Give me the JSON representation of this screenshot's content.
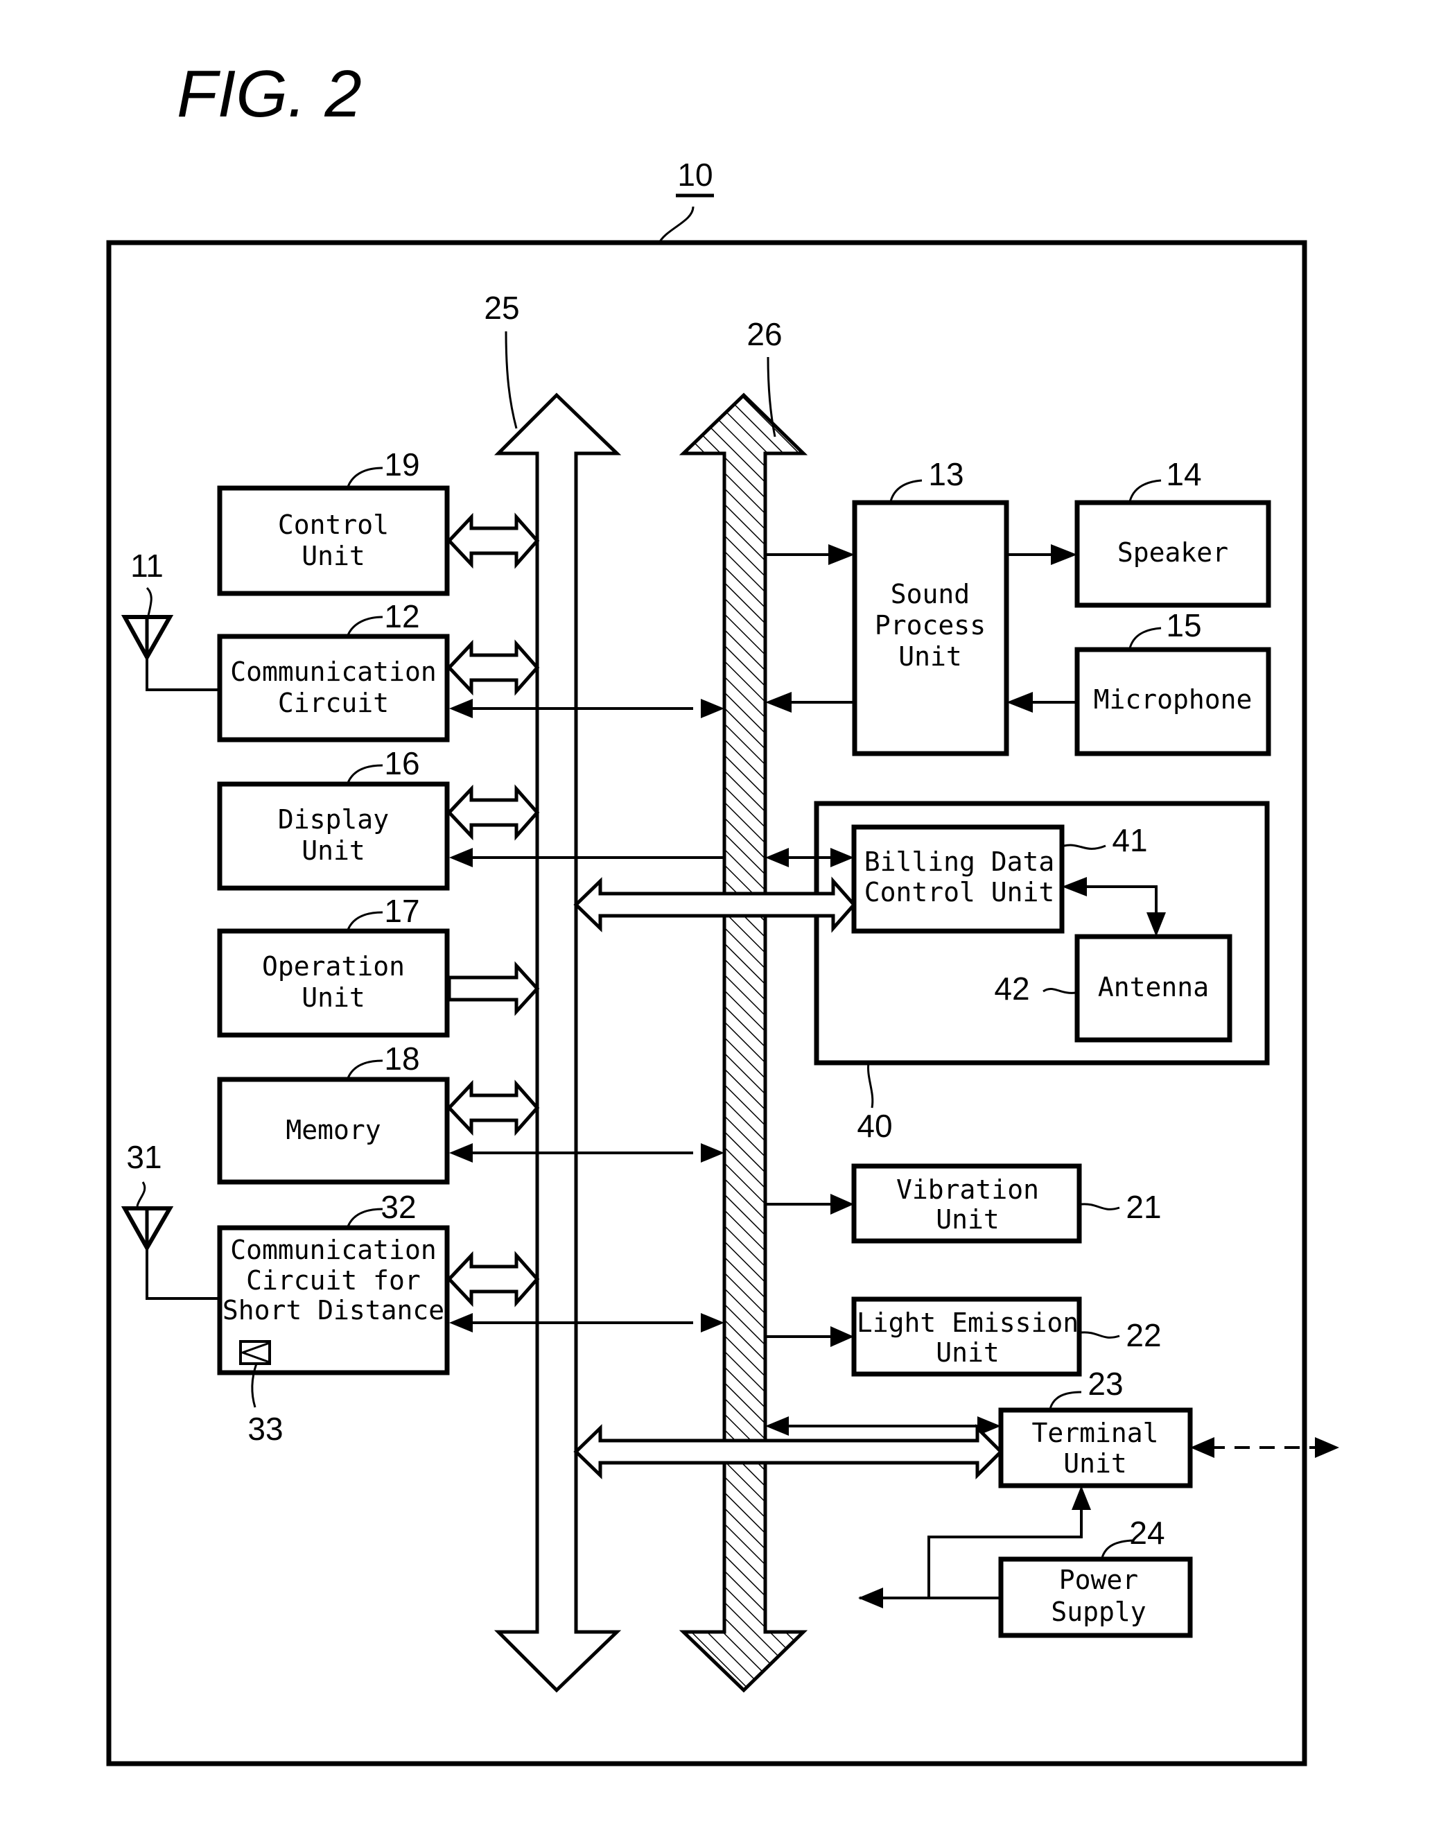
{
  "figure": {
    "title": "FIG. 2",
    "device_ref": "10"
  },
  "buses": [
    {
      "id": "bus25",
      "ref": "25",
      "style": "hollow"
    },
    {
      "id": "bus26",
      "ref": "26",
      "style": "hatched"
    }
  ],
  "blocks": {
    "control_unit": {
      "ref": "19",
      "lines": [
        "Control",
        "Unit"
      ]
    },
    "communication_circuit": {
      "ref": "12",
      "lines": [
        "Communication",
        "Circuit"
      ]
    },
    "display_unit": {
      "ref": "16",
      "lines": [
        "Display",
        "Unit"
      ]
    },
    "operation_unit": {
      "ref": "17",
      "lines": [
        "Operation",
        "Unit"
      ]
    },
    "memory": {
      "ref": "18",
      "lines": [
        "Memory"
      ]
    },
    "short_distance_circuit": {
      "ref": "32",
      "lines": [
        "Communication",
        "Circuit for",
        "Short Distance"
      ]
    },
    "sound_process_unit": {
      "ref": "13",
      "lines": [
        "Sound",
        "Process",
        "Unit"
      ]
    },
    "speaker": {
      "ref": "14",
      "lines": [
        "Speaker"
      ]
    },
    "microphone": {
      "ref": "15",
      "lines": [
        "Microphone"
      ]
    },
    "billing_module": {
      "ref": "40"
    },
    "billing_data_control_unit": {
      "ref": "41",
      "lines": [
        "Billing Data",
        "Control Unit"
      ]
    },
    "antenna_block": {
      "ref": "42",
      "lines": [
        "Antenna"
      ]
    },
    "vibration_unit": {
      "ref": "21",
      "lines": [
        "Vibration",
        "Unit"
      ]
    },
    "light_emission_unit": {
      "ref": "22",
      "lines": [
        "Light Emission",
        "Unit"
      ]
    },
    "terminal_unit": {
      "ref": "23",
      "lines": [
        "Terminal",
        "Unit"
      ]
    },
    "power_supply": {
      "ref": "24",
      "lines": [
        "Power",
        "Supply"
      ]
    }
  },
  "antennas": {
    "main_antenna": {
      "ref": "11"
    },
    "short_antenna": {
      "ref": "31"
    },
    "short_element": {
      "ref": "33"
    }
  }
}
